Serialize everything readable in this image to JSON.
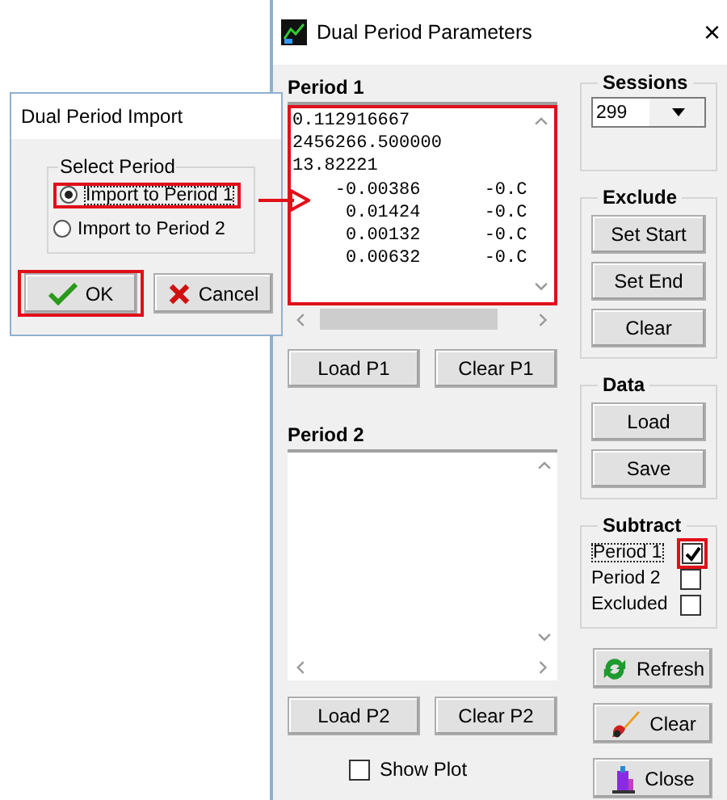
{
  "import_dialog": {
    "title": "Dual Period Import",
    "group_label": "Select Period",
    "options": [
      {
        "label": "Import to Period 1",
        "selected": true,
        "focused": true,
        "highlighted": true
      },
      {
        "label": "Import to Period 2",
        "selected": false,
        "focused": false,
        "highlighted": false
      }
    ],
    "buttons": [
      {
        "kind": "ok",
        "label": "OK",
        "highlighted": true
      },
      {
        "kind": "cancel",
        "label": "Cancel",
        "highlighted": false
      }
    ]
  },
  "annotation_arrow": true,
  "params_dialog": {
    "title": "Dual Period Parameters",
    "close": "×",
    "period1": {
      "label": "Period 1",
      "highlighted": true,
      "lines": [
        "0.112916667",
        "2456266.500000",
        "13.82221",
        "    -0.00386      -0.C",
        "     0.01424      -0.C",
        "     0.00132      -0.C",
        "     0.00632      -0.C"
      ],
      "buttons": [
        "Load P1",
        "Clear P1"
      ]
    },
    "period2": {
      "label": "Period 2",
      "highlighted": false,
      "buttons": [
        "Load P2",
        "Clear P2"
      ]
    },
    "show_plot": {
      "label": "Show Plot",
      "checked": false
    },
    "sessions": {
      "label": "Sessions",
      "value": "299"
    },
    "exclude": {
      "label": "Exclude",
      "buttons": [
        "Set Start",
        "Set End",
        "Clear"
      ]
    },
    "data": {
      "label": "Data",
      "buttons": [
        "Load",
        "Save"
      ]
    },
    "subtract": {
      "label": "Subtract",
      "items": [
        {
          "label": "Period 1",
          "checked": true,
          "focused": true,
          "highlighted": true
        },
        {
          "label": "Period 2",
          "checked": false,
          "focused": false,
          "highlighted": false
        },
        {
          "label": "Excluded",
          "checked": false,
          "focused": false,
          "highlighted": false
        }
      ]
    },
    "actions": [
      {
        "kind": "refresh",
        "label": "Refresh"
      },
      {
        "kind": "clear",
        "label": "Clear"
      },
      {
        "kind": "close",
        "label": "Close"
      }
    ]
  }
}
